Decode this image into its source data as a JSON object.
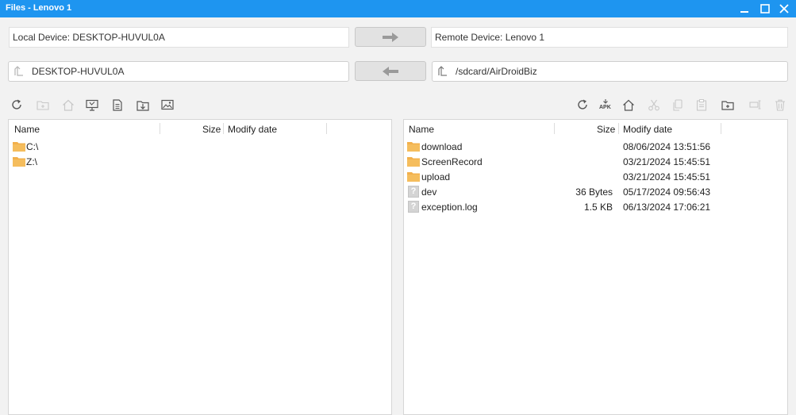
{
  "window": {
    "title": "Files - Lenovo 1",
    "accent": "#1e95f0"
  },
  "local": {
    "device_label": "Local Device: DESKTOP-HUVUL0A",
    "path": "DESKTOP-HUVUL0A",
    "columns": {
      "name": "Name",
      "size": "Size",
      "date": "Modify date"
    },
    "files": [
      {
        "name": "C:\\",
        "size": "",
        "date": "",
        "type": "folder"
      },
      {
        "name": "Z:\\",
        "size": "",
        "date": "",
        "type": "folder"
      }
    ]
  },
  "remote": {
    "device_label": "Remote Device: Lenovo 1",
    "path": "/sdcard/AirDroidBiz",
    "columns": {
      "name": "Name",
      "size": "Size",
      "date": "Modify date"
    },
    "files": [
      {
        "name": "download",
        "size": "",
        "date": "08/06/2024 13:51:56",
        "type": "folder"
      },
      {
        "name": "ScreenRecord",
        "size": "",
        "date": "03/21/2024 15:45:51",
        "type": "folder"
      },
      {
        "name": "upload",
        "size": "",
        "date": "03/21/2024 15:45:51",
        "type": "folder"
      },
      {
        "name": "dev",
        "size": "36 Bytes",
        "date": "05/17/2024 09:56:43",
        "type": "unknown"
      },
      {
        "name": "exception.log",
        "size": "1.5 KB",
        "date": "06/13/2024 17:06:21",
        "type": "unknown"
      }
    ]
  },
  "toolbar": {
    "apk_label": "APK",
    "local_icons": [
      "refresh-icon",
      "new-folder-icon",
      "home-icon",
      "desktop-icon",
      "document-icon",
      "download-icon",
      "image-icon"
    ],
    "remote_icons": [
      "refresh-icon",
      "apk-icon",
      "home-icon",
      "cut-icon",
      "copy-icon",
      "paste-icon",
      "new-folder-icon",
      "rename-icon",
      "delete-icon"
    ]
  },
  "transfer": {
    "upload_icon": "arrow-right-icon",
    "download_icon": "arrow-left-icon"
  }
}
